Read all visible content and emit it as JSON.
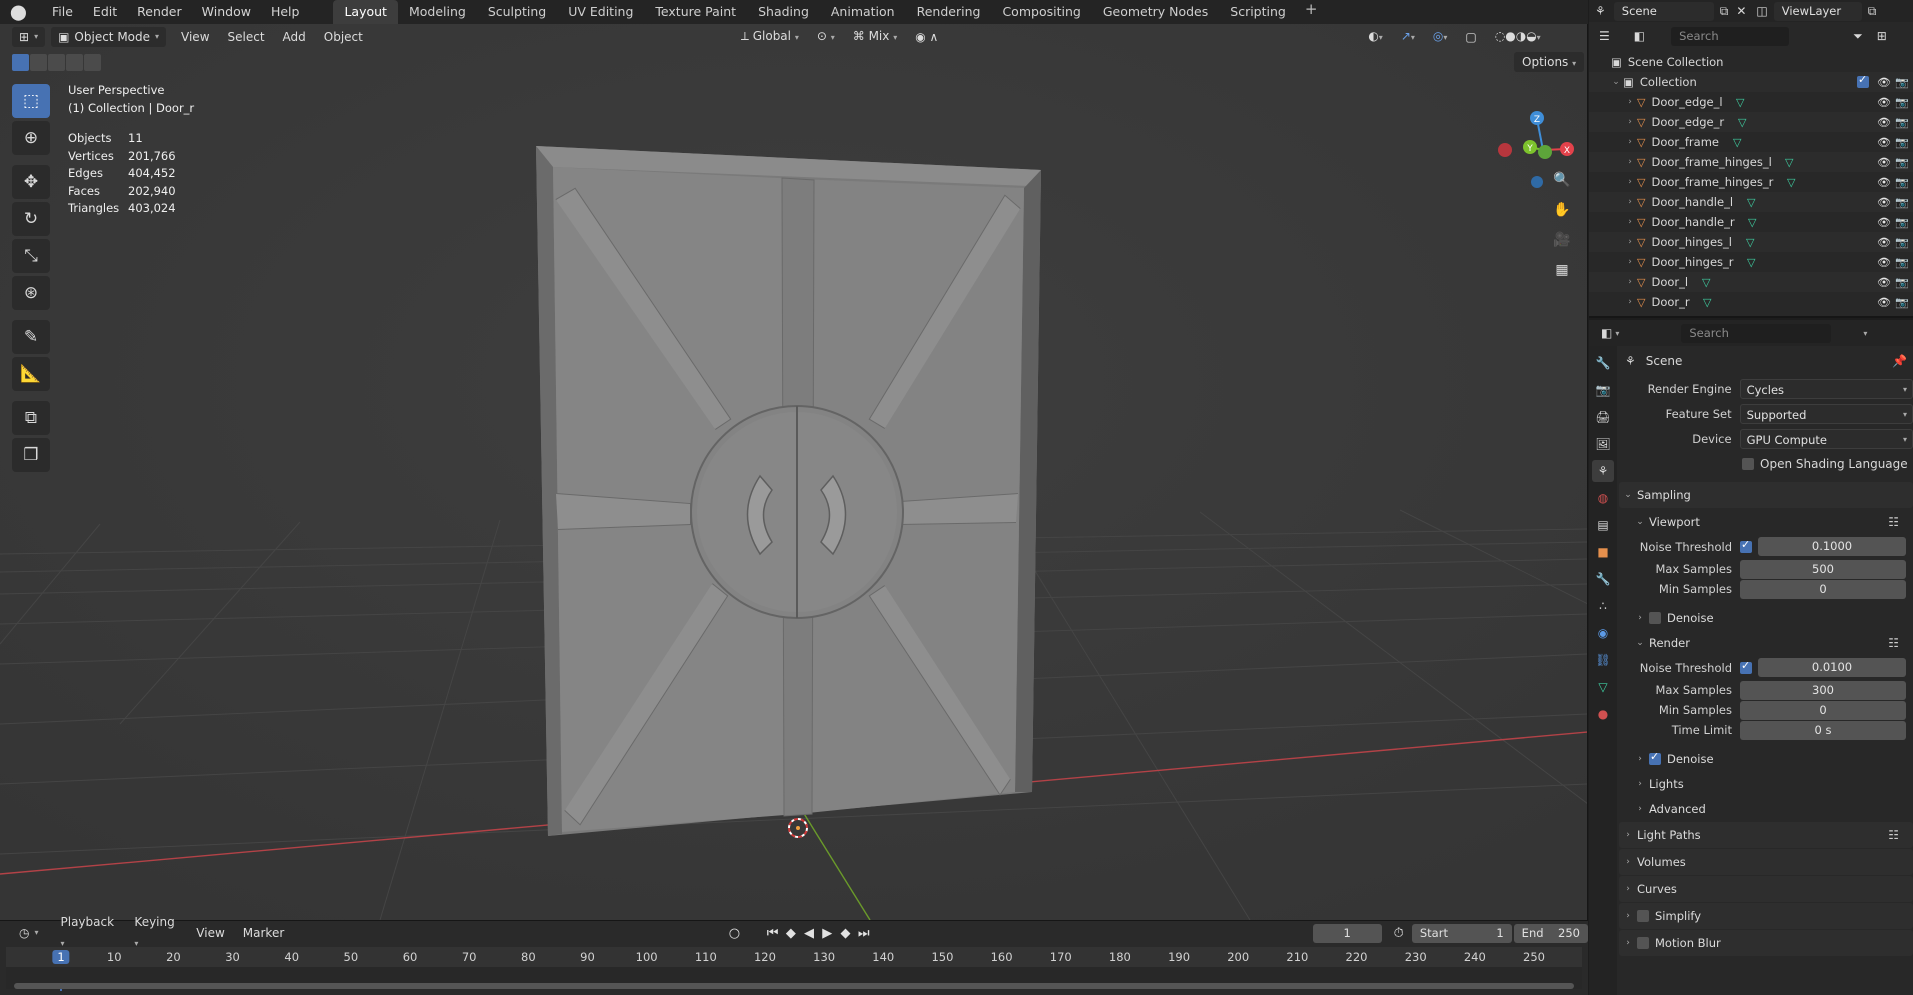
{
  "menu": [
    "File",
    "Edit",
    "Render",
    "Window",
    "Help"
  ],
  "workspaces": [
    "Layout",
    "Modeling",
    "Sculpting",
    "UV Editing",
    "Texture Paint",
    "Shading",
    "Animation",
    "Rendering",
    "Compositing",
    "Geometry Nodes",
    "Scripting"
  ],
  "active_workspace": "Layout",
  "top_right": {
    "scene": "Scene",
    "view_layer": "ViewLayer"
  },
  "viewport": {
    "mode": "Object Mode",
    "menus": [
      "View",
      "Select",
      "Add",
      "Object"
    ],
    "orientation": "Global",
    "mix": "Mix",
    "options": "Options",
    "perspective": "User Perspective",
    "collection_info": "(1) Collection | Door_r",
    "stats": [
      {
        "label": "Objects",
        "value": "11"
      },
      {
        "label": "Vertices",
        "value": "201,766"
      },
      {
        "label": "Edges",
        "value": "404,452"
      },
      {
        "label": "Faces",
        "value": "202,940"
      },
      {
        "label": "Triangles",
        "value": "403,024"
      }
    ],
    "gizmo": {
      "z": "Z",
      "y": "Y",
      "x": "X"
    }
  },
  "timeline": {
    "menus": [
      "Playback",
      "Keying",
      "View",
      "Marker"
    ],
    "current_frame": "1",
    "start_label": "Start",
    "start": "1",
    "end_label": "End",
    "end": "250",
    "ticks": [
      "1",
      "10",
      "20",
      "30",
      "40",
      "50",
      "60",
      "70",
      "80",
      "90",
      "100",
      "110",
      "120",
      "130",
      "140",
      "150",
      "160",
      "170",
      "180",
      "190",
      "200",
      "210",
      "220",
      "230",
      "240",
      "250"
    ]
  },
  "outliner": {
    "search_placeholder": "Search",
    "root": "Scene Collection",
    "collection": "Collection",
    "items": [
      "Door_edge_l",
      "Door_edge_r",
      "Door_frame",
      "Door_frame_hinges_l",
      "Door_frame_hinges_r",
      "Door_handle_l",
      "Door_handle_r",
      "Door_hinges_l",
      "Door_hinges_r",
      "Door_l",
      "Door_r"
    ]
  },
  "properties": {
    "search_placeholder": "Search",
    "context": "Scene",
    "render_engine_label": "Render Engine",
    "render_engine": "Cycles",
    "feature_set_label": "Feature Set",
    "feature_set": "Supported",
    "device_label": "Device",
    "device": "GPU Compute",
    "osl_label": "Open Shading Language",
    "sampling": "Sampling",
    "viewport_label": "Viewport",
    "vp_noise_threshold_label": "Noise Threshold",
    "vp_noise_threshold": "0.1000",
    "vp_max_samples_label": "Max Samples",
    "vp_max_samples": "500",
    "vp_min_samples_label": "Min Samples",
    "vp_min_samples": "0",
    "vp_denoise": "Denoise",
    "render_label": "Render",
    "r_noise_threshold_label": "Noise Threshold",
    "r_noise_threshold": "0.0100",
    "r_max_samples_label": "Max Samples",
    "r_max_samples": "300",
    "r_min_samples_label": "Min Samples",
    "r_min_samples": "0",
    "r_time_limit_label": "Time Limit",
    "r_time_limit": "0 s",
    "r_denoise": "Denoise",
    "lights": "Lights",
    "advanced": "Advanced",
    "light_paths": "Light Paths",
    "volumes": "Volumes",
    "curves": "Curves",
    "simplify": "Simplify",
    "motion_blur": "Motion Blur"
  },
  "colors": {
    "accent": "#4772b3",
    "mesh_orange": "#e6904d",
    "mesh_data_green": "#3fcfa2",
    "axis_x": "#e3424b",
    "axis_y": "#7dc22c",
    "axis_z": "#3f8ed8"
  }
}
